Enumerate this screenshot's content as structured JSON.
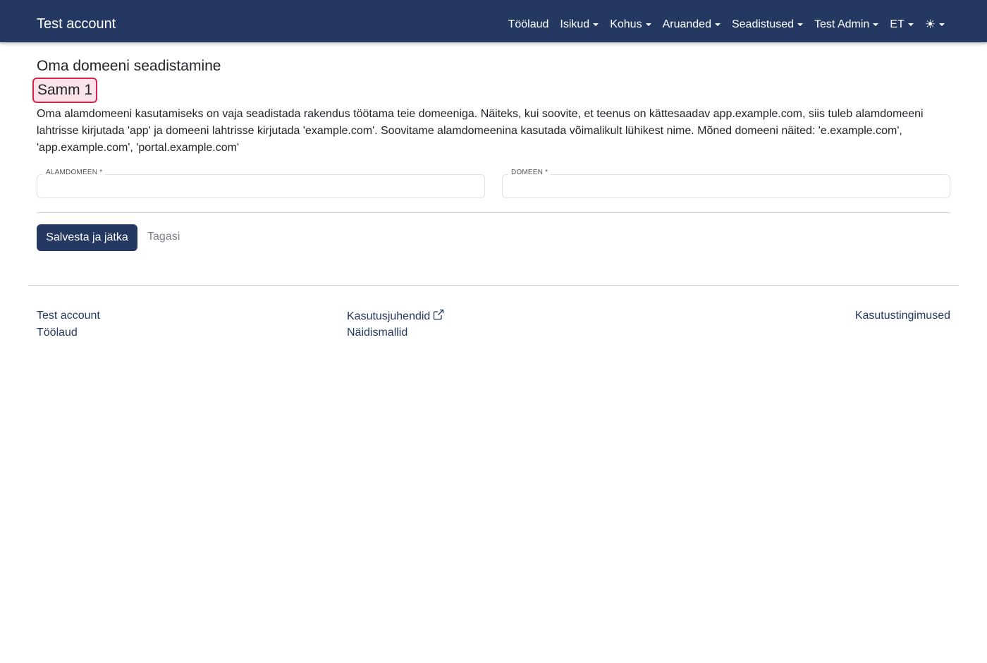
{
  "header": {
    "brand": "Test account",
    "nav": [
      {
        "label": "Töölaud",
        "dropdown": false
      },
      {
        "label": "Isikud",
        "dropdown": true
      },
      {
        "label": "Kohus",
        "dropdown": true
      },
      {
        "label": "Aruanded",
        "dropdown": true
      },
      {
        "label": "Seadistused",
        "dropdown": true
      },
      {
        "label": "Test Admin",
        "dropdown": true
      },
      {
        "label": "ET",
        "dropdown": true
      }
    ],
    "theme_icon": "☀",
    "theme_icon_name": "sun-icon"
  },
  "main": {
    "title": "Oma domeeni seadistamine",
    "step": "Samm 1",
    "description": "Oma alamdomeeni kasutamiseks on vaja seadistada rakendus töötama teie domeeniga. Näiteks, kui soovite, et teenus on kättesaadav app.example.com, siis tuleb alamdomeeni lahtrisse kirjutada 'app' ja domeeni lahtrisse kirjutada 'example.com'. Soovitame alamdomeenina kasutada võimalikult lühikest nime. Mõned domeeni näited: 'e.example.com', 'app.example.com', 'portal.example.com'",
    "fields": {
      "subdomain": {
        "label": "ALAMDOMEEN *",
        "value": "",
        "placeholder": ""
      },
      "domain": {
        "label": "DOMEEN *",
        "value": "",
        "placeholder": ""
      }
    },
    "buttons": {
      "save": "Salvesta ja jätka",
      "back": "Tagasi"
    }
  },
  "footer": {
    "col1": [
      "Test account",
      "Töölaud"
    ],
    "col2": [
      "Kasutusjuhendid",
      "Näidismallid"
    ],
    "col3": [
      "Kasutustingimused"
    ],
    "external_icon": "external-link-icon"
  },
  "colors": {
    "primary": "#253861",
    "step_border": "#d6244b",
    "step_bg": "#fbe3ea",
    "muted_link": "#7a7f85"
  }
}
